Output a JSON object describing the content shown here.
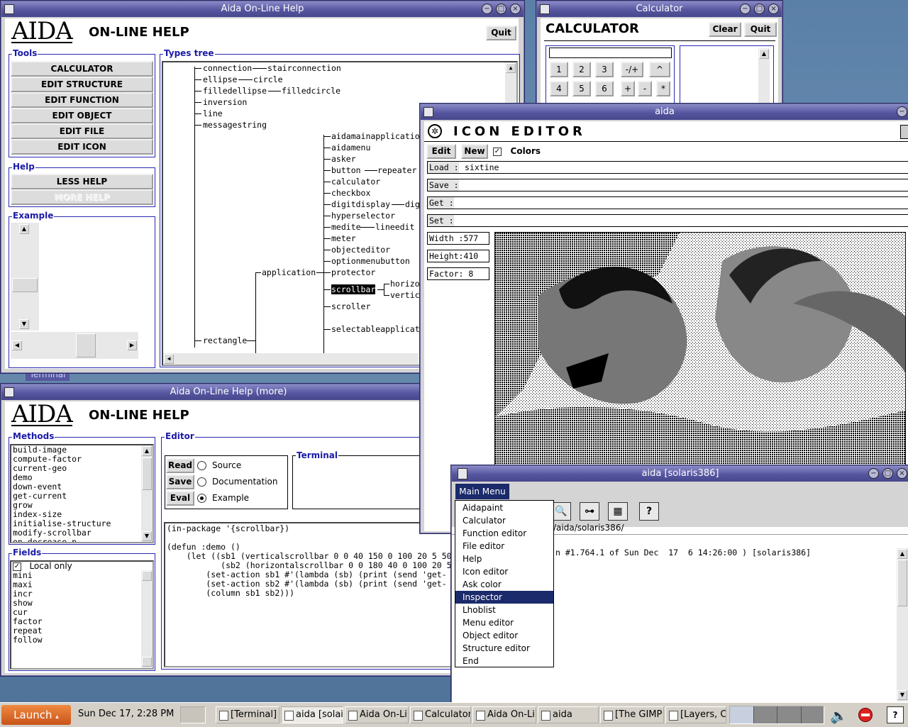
{
  "help_window": {
    "title": "Aida On-Line Help",
    "logo": "AIDA",
    "heading": "ON-LINE HELP",
    "quit_label": "Quit",
    "tools_legend": "Tools",
    "tools": [
      "CALCULATOR",
      "EDIT STRUCTURE",
      "EDIT FUNCTION",
      "EDIT OBJECT",
      "EDIT FILE",
      "EDIT ICON"
    ],
    "help_legend": "Help",
    "help_buttons": [
      "LESS HELP",
      "MORE HELP"
    ],
    "example_legend": "Example",
    "types_legend": "Types tree",
    "tree": {
      "connection": "connection",
      "stairconnection": "stairconnection",
      "ellipse": "ellipse",
      "circle": "circle",
      "filledellipse": "filledellipse",
      "filledcircle": "filledcircle",
      "inversion": "inversion",
      "line": "line",
      "messagestring": "messagestring",
      "aidamainapplication": "aidamainapplication",
      "aidamenu": "aidamenu",
      "asker": "asker",
      "button": "button",
      "repeater": "repeater",
      "calculator": "calculator",
      "checkbox": "checkbox",
      "digitdisplay": "digitdisplay",
      "dig": "dig",
      "hyperselector": "hyperselector",
      "medite": "medite",
      "lineedit": "lineedit",
      "meter": "meter",
      "objecteditor": "objecteditor",
      "optionmenubutton": "optionmenubutton",
      "application": "application",
      "protector": "protector",
      "scrollbar": "scrollbar",
      "horizo": "horizo",
      "vertic": "vertic",
      "scroller": "scroller",
      "selectableapplicat": "selectableapplicat",
      "rectangle": "rectangle"
    }
  },
  "calculator_window": {
    "title": "Calculator",
    "heading": "CALCULATOR",
    "clear_label": "Clear",
    "quit_label": "Quit",
    "keys_row1": [
      "1",
      "2",
      "3",
      "-/+",
      "^"
    ],
    "keys_row2": [
      "4",
      "5",
      "6",
      "+",
      "-",
      "*"
    ]
  },
  "more_window": {
    "title": "Aida On-Line Help (more)",
    "logo": "AIDA",
    "heading": "ON-LINE HELP",
    "methods_legend": "Methods",
    "methods": [
      "build-image",
      "compute-factor",
      "current-geo",
      "demo",
      "down-event",
      "get-current",
      "grow",
      "index-size",
      "initialise-structure",
      "modify-scrollbar",
      "on-decrease-p"
    ],
    "editor_legend": "Editor",
    "editor_buttons": [
      "Read",
      "Save",
      "Eval"
    ],
    "radio_options": [
      "Source",
      "Documentation",
      "Example"
    ],
    "radio_selected": "Example",
    "terminal_legend": "Terminal",
    "fields_legend": "Fields",
    "local_only_label": "Local only",
    "local_only_checked": true,
    "fields": [
      "mini",
      "maxi",
      "incr",
      "show",
      "cur",
      "factor",
      "repeat",
      "follow"
    ],
    "code": [
      "(in-package '{scrollbar})",
      "",
      "(defun :demo ()",
      "    (let ((sb1 (verticalscrollbar 0 0 40 150 0 100 20 5 50",
      "           (sb2 (horizontalscrollbar 0 0 180 40 0 100 20 5",
      "        (set-action sb1 #'(lambda (sb) (print (send 'get-",
      "        (set-action sb2 #'(lambda (sb) (print (send 'get-",
      "        (column sb1 sb2)))"
    ]
  },
  "icon_window": {
    "title": "aida",
    "heading": "ICON EDITOR",
    "edit_label": "Edit",
    "new_label": "New",
    "colors_label": "Colors",
    "colors_checked": true,
    "load_label": "Load  :",
    "load_value": "sixtine",
    "save_label": "Save  :",
    "get_label": "Get   :",
    "set_label": "Set   :",
    "width_text": "Width :577",
    "height_text": "Height:410",
    "factor_text": "Factor: 8"
  },
  "main_window": {
    "title": "aida [solaris386]",
    "menu_button": "Main Menu",
    "menu_items": [
      "Aidapaint",
      "Calculator",
      "Function editor",
      "File editor",
      "Help",
      "Icon editor",
      "Ask color",
      "Inspector",
      "Lhoblist",
      "Menu editor",
      "Object editor",
      "Structure editor",
      "End"
    ],
    "selected_item": "Inspector",
    "path": "/aida/solaris386/",
    "version_line": "n #1.764.1 of Sun Dec  17  6 14:26:00 ) [solaris386]",
    "toolbar_icons": [
      "zoom-icon",
      "tree-icon",
      "book-icon",
      "question-icon"
    ]
  },
  "behind_label": "Terminal",
  "taskbar": {
    "launch_label": "Launch",
    "clock": "Sun Dec 17,  2:28 PM",
    "tasks": [
      "[Terminal]",
      "aida [solai",
      "Aida On-Li",
      "Calculator",
      "Aida On-Li",
      "aida",
      "[The GIMP",
      "[Layers, C"
    ],
    "active_task": "aida [solai"
  },
  "colors": {
    "title_bar": "#5656a0",
    "legend_blue": "#1a1aa8",
    "menu_highlight": "#1a2a6a",
    "launch_orange": "#e06a20",
    "desktop": "#5b80a8"
  }
}
